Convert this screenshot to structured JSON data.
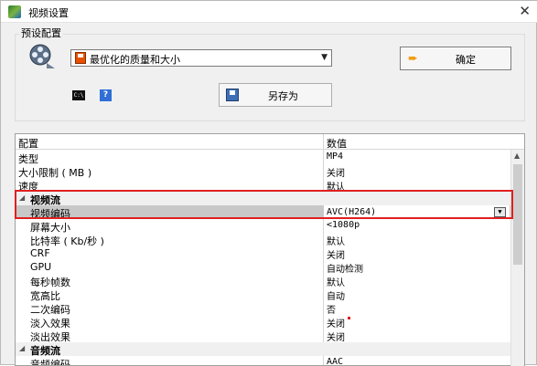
{
  "window": {
    "title": "视频设置"
  },
  "preset": {
    "group_label": "预设配置",
    "selected": "最优化的质量和大小",
    "ok_label": "确定",
    "save_as_label": "另存为"
  },
  "grid": {
    "header": {
      "name": "配置",
      "value": "数值"
    },
    "rows": [
      {
        "name": "类型",
        "value": "MP4"
      },
      {
        "name": "大小限制 ( MB )",
        "value": "关闭"
      },
      {
        "name": "速度",
        "value": "默认"
      },
      {
        "name": "视频流",
        "value": ""
      },
      {
        "name": "视频编码",
        "value": "AVC(H264)"
      },
      {
        "name": "屏幕大小",
        "value": "<1080p"
      },
      {
        "name": "比特率 ( Kb/秒 )",
        "value": "默认"
      },
      {
        "name": "CRF",
        "value": "关闭"
      },
      {
        "name": "GPU",
        "value": "自动检测"
      },
      {
        "name": "每秒帧数",
        "value": "默认"
      },
      {
        "name": "宽高比",
        "value": "自动"
      },
      {
        "name": "二次编码",
        "value": "否"
      },
      {
        "name": "淡入效果",
        "value": "关闭"
      },
      {
        "name": "淡出效果",
        "value": "关闭"
      },
      {
        "name": "音频流",
        "value": ""
      },
      {
        "name": "音频编码",
        "value": "AAC"
      }
    ]
  },
  "colors": {
    "highlight": "#e02020",
    "ok_arrow": "#f39c12"
  },
  "icons": [
    "app-icon",
    "close-icon",
    "film-reel-icon",
    "floppy-icon",
    "chevron-down-icon",
    "arrow-right-icon",
    "cmd-icon",
    "help-icon",
    "save-icon",
    "collapse-triangle-icon",
    "scroll-up-icon"
  ]
}
